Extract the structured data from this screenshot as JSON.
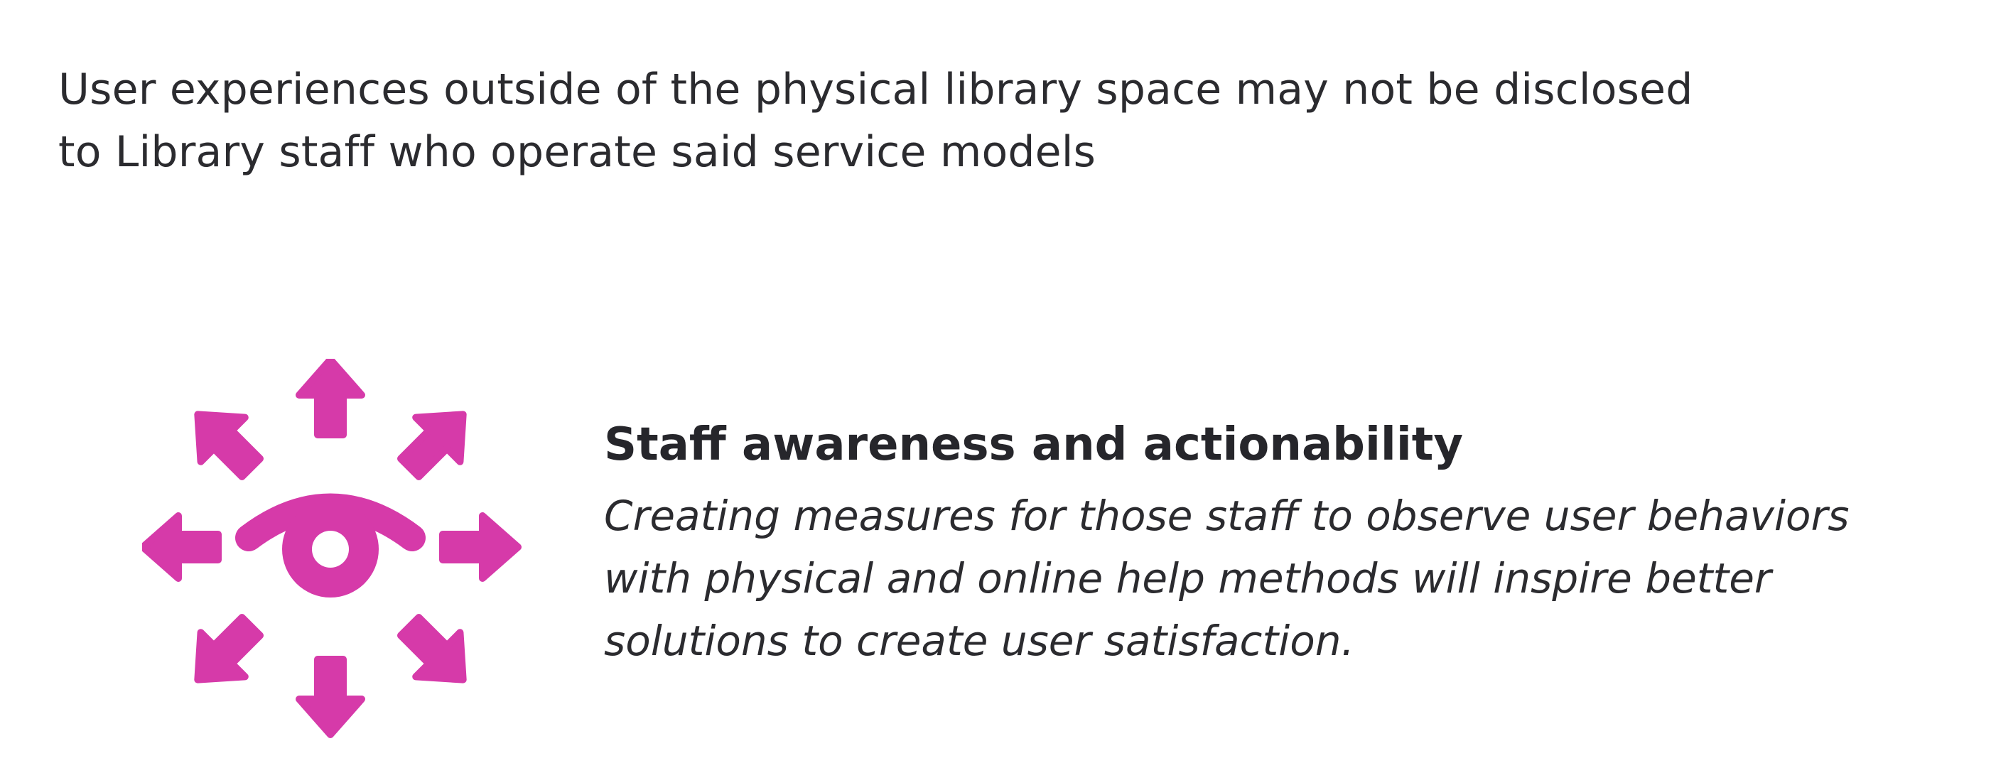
{
  "intro": {
    "lines": [
      "User experiences outside of the physical library space may not be disclosed",
      "to Library staff who operate said service models"
    ]
  },
  "feature": {
    "icon": "eye-with-radiating-arrows-icon",
    "title": "Staff awareness and actionability",
    "body_lines": [
      "Creating measures for those staff to observe user behaviors",
      "with physical and online help methods will inspire better",
      "solutions to create user satisfaction."
    ]
  },
  "colors": {
    "icon": "#d63aa9",
    "text": "#2b2b2f",
    "background": "#ffffff"
  }
}
